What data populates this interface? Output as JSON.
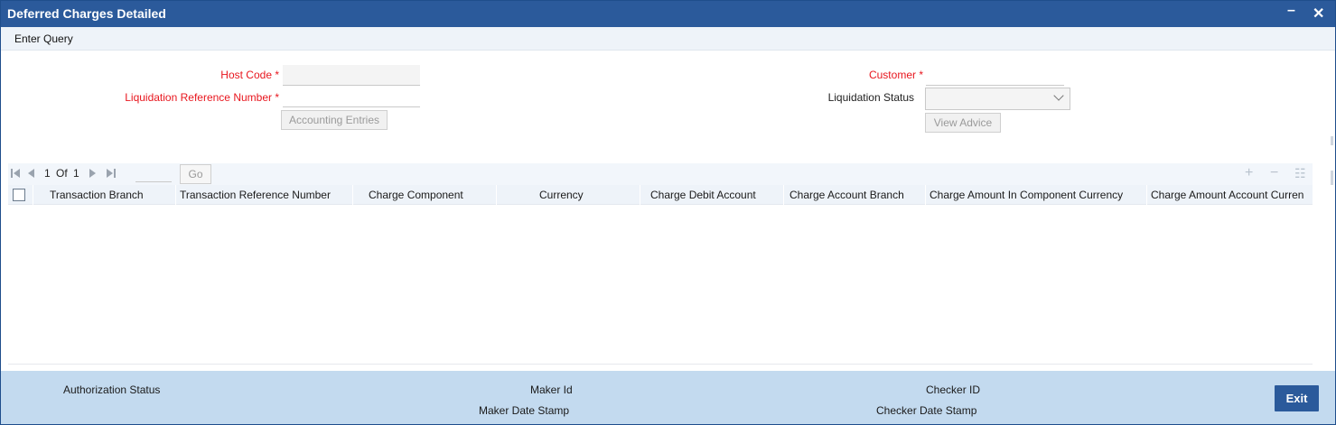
{
  "window": {
    "title": "Deferred Charges Detailed",
    "minimize_symbol": "–",
    "close_symbol": "✕"
  },
  "menu": {
    "enter_query": "Enter Query"
  },
  "form": {
    "host_code_label": "Host Code *",
    "host_code_value": "",
    "liq_ref_label": "Liquidation Reference Number *",
    "liq_ref_value": "",
    "accounting_entries_button": "Accounting Entries",
    "customer_label": "Customer *",
    "customer_value": "",
    "liq_status_label": "Liquidation Status",
    "liq_status_value": "",
    "view_advice_button": "View Advice"
  },
  "grid": {
    "pagination": {
      "current": "1",
      "of_label": "Of",
      "total": "1",
      "go_label": "Go"
    },
    "columns": [
      "Transaction Branch",
      "Transaction Reference Number",
      "Charge Component",
      "Currency",
      "Charge Debit Account",
      "Charge Account Branch",
      "Charge Amount In Component Currency",
      "Charge Amount Account Curren"
    ],
    "rows": []
  },
  "footer": {
    "authorization_status": "Authorization Status",
    "maker_id": "Maker Id",
    "maker_date_stamp": "Maker Date Stamp",
    "checker_id": "Checker ID",
    "checker_date_stamp": "Checker Date Stamp",
    "exit_button": "Exit"
  },
  "icons": {
    "first_page": "first-page-icon",
    "prev_page": "prev-page-icon",
    "next_page": "next-page-icon",
    "last_page": "last-page-icon",
    "add_row": "add-row-icon",
    "delete_row": "delete-row-icon",
    "single_view": "single-view-icon"
  },
  "colors": {
    "titlebar": "#2b5a9b",
    "required_label": "#e8161e",
    "footer": "#c3daef",
    "grid_header": "#eef3f9"
  }
}
